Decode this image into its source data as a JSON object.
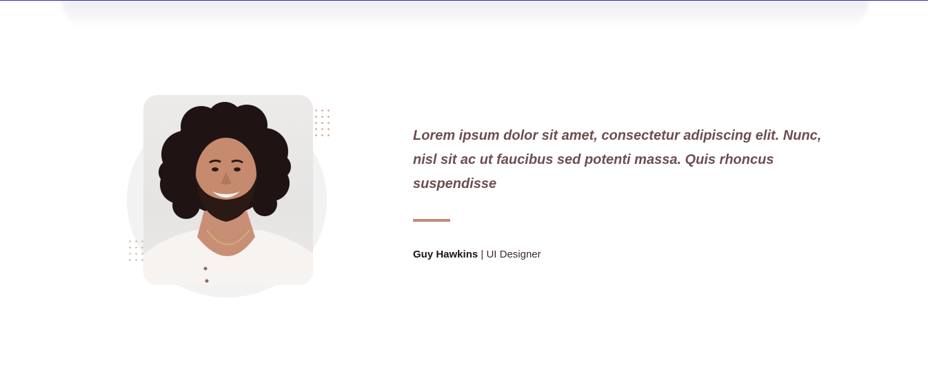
{
  "testimonial": {
    "quote": "Lorem ipsum dolor sit amet, consectetur adipiscing elit. Nunc, nisl sit ac ut faucibus sed potenti massa. Quis rhoncus suspendisse",
    "author_name": "Guy Hawkins",
    "separator": " | ",
    "author_role": "UI Designer",
    "photo_icon": "portrait-photo"
  },
  "colors": {
    "quote_text": "#6b4f51",
    "accent": "#c08a78",
    "top_rule": "#2c2ccf"
  }
}
